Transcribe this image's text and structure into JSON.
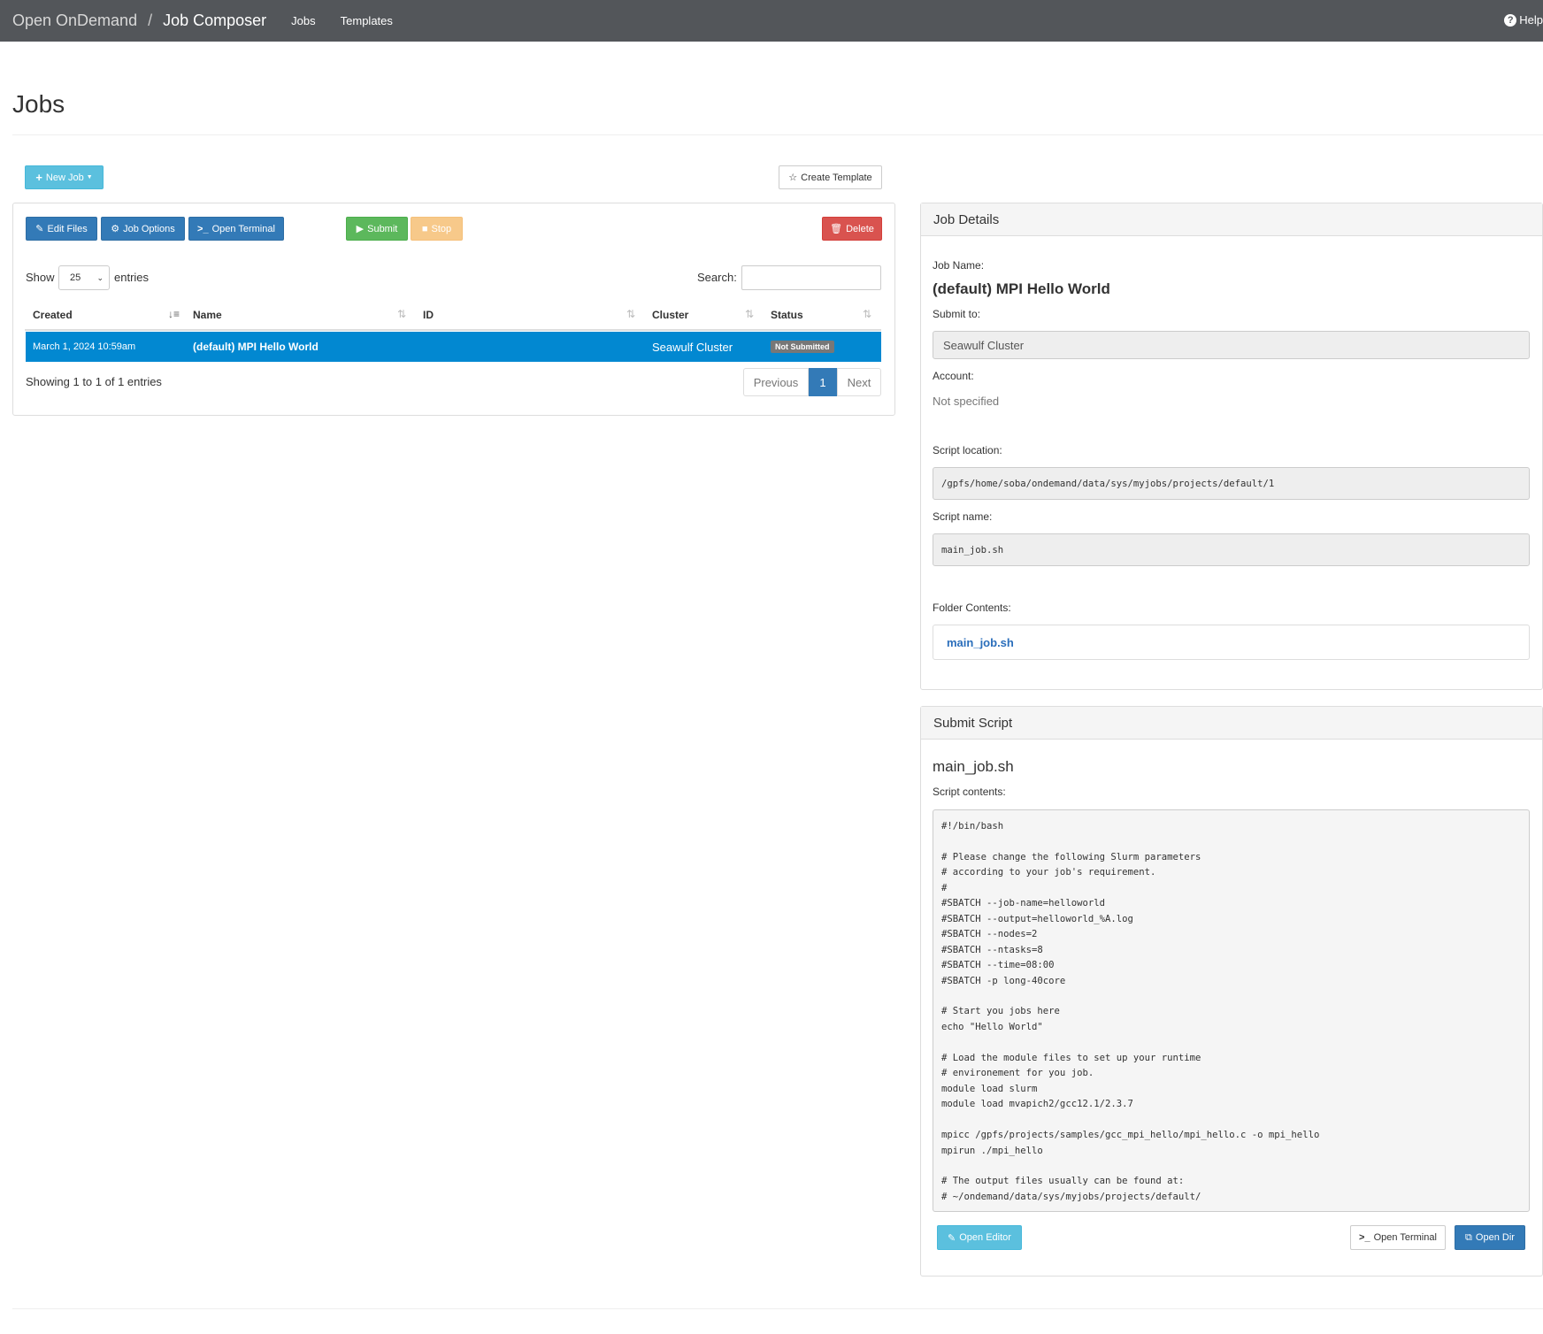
{
  "navbar": {
    "brand": "Open OnDemand",
    "separator": "/",
    "app": "Job Composer",
    "links": [
      "Jobs",
      "Templates"
    ],
    "help": "Help"
  },
  "page": {
    "title": "Jobs"
  },
  "toolbar": {
    "new_job": "New Job",
    "create_template": "Create Template",
    "edit_files": "Edit Files",
    "job_options": "Job Options",
    "open_terminal": "Open Terminal",
    "submit": "Submit",
    "stop": "Stop",
    "delete": "Delete"
  },
  "table": {
    "show_label": "Show",
    "page_size": "25",
    "entries_label": "entries",
    "search_label": "Search:",
    "columns": [
      "Created",
      "Name",
      "ID",
      "Cluster",
      "Status"
    ],
    "rows": [
      {
        "created": "March 1, 2024 10:59am",
        "name": "(default) MPI Hello World",
        "id": "",
        "cluster": "Seawulf Cluster",
        "status": "Not Submitted"
      }
    ],
    "info": "Showing 1 to 1 of 1 entries",
    "pagination": {
      "previous": "Previous",
      "current": "1",
      "next": "Next"
    }
  },
  "job_details": {
    "heading": "Job Details",
    "job_name_label": "Job Name:",
    "job_name": "(default) MPI Hello World",
    "submit_to_label": "Submit to:",
    "submit_to": "Seawulf Cluster",
    "account_label": "Account:",
    "account": "Not specified",
    "script_location_label": "Script location:",
    "script_location": "/gpfs/home/soba/ondemand/data/sys/myjobs/projects/default/1",
    "script_name_label": "Script name:",
    "script_name": "main_job.sh",
    "folder_contents_label": "Folder Contents:",
    "folder_file": "main_job.sh"
  },
  "submit_script": {
    "heading": "Submit Script",
    "filename": "main_job.sh",
    "contents_label": "Script contents:",
    "contents": "#!/bin/bash\n\n# Please change the following Slurm parameters\n# according to your job's requirement.\n#\n#SBATCH --job-name=helloworld\n#SBATCH --output=helloworld_%A.log\n#SBATCH --nodes=2\n#SBATCH --ntasks=8\n#SBATCH --time=08:00\n#SBATCH -p long-40core\n\n# Start you jobs here\necho \"Hello World\"\n\n# Load the module files to set up your runtime\n# environement for you job.\nmodule load slurm\nmodule load mvapich2/gcc12.1/2.3.7\n\nmpicc /gpfs/projects/samples/gcc_mpi_hello/mpi_hello.c -o mpi_hello\nmpirun ./mpi_hello\n\n# The output files usually can be found at:\n# ~/ondemand/data/sys/myjobs/projects/default/",
    "open_editor": "Open Editor",
    "open_terminal": "Open Terminal",
    "open_dir": "Open Dir"
  },
  "colors": {
    "navbar": "#53565a",
    "selected_row": "#0288d1",
    "primary": "#337ab7",
    "info": "#5bc0de",
    "success": "#5cb85c",
    "warning": "#f7c98a",
    "danger": "#d9534f"
  }
}
